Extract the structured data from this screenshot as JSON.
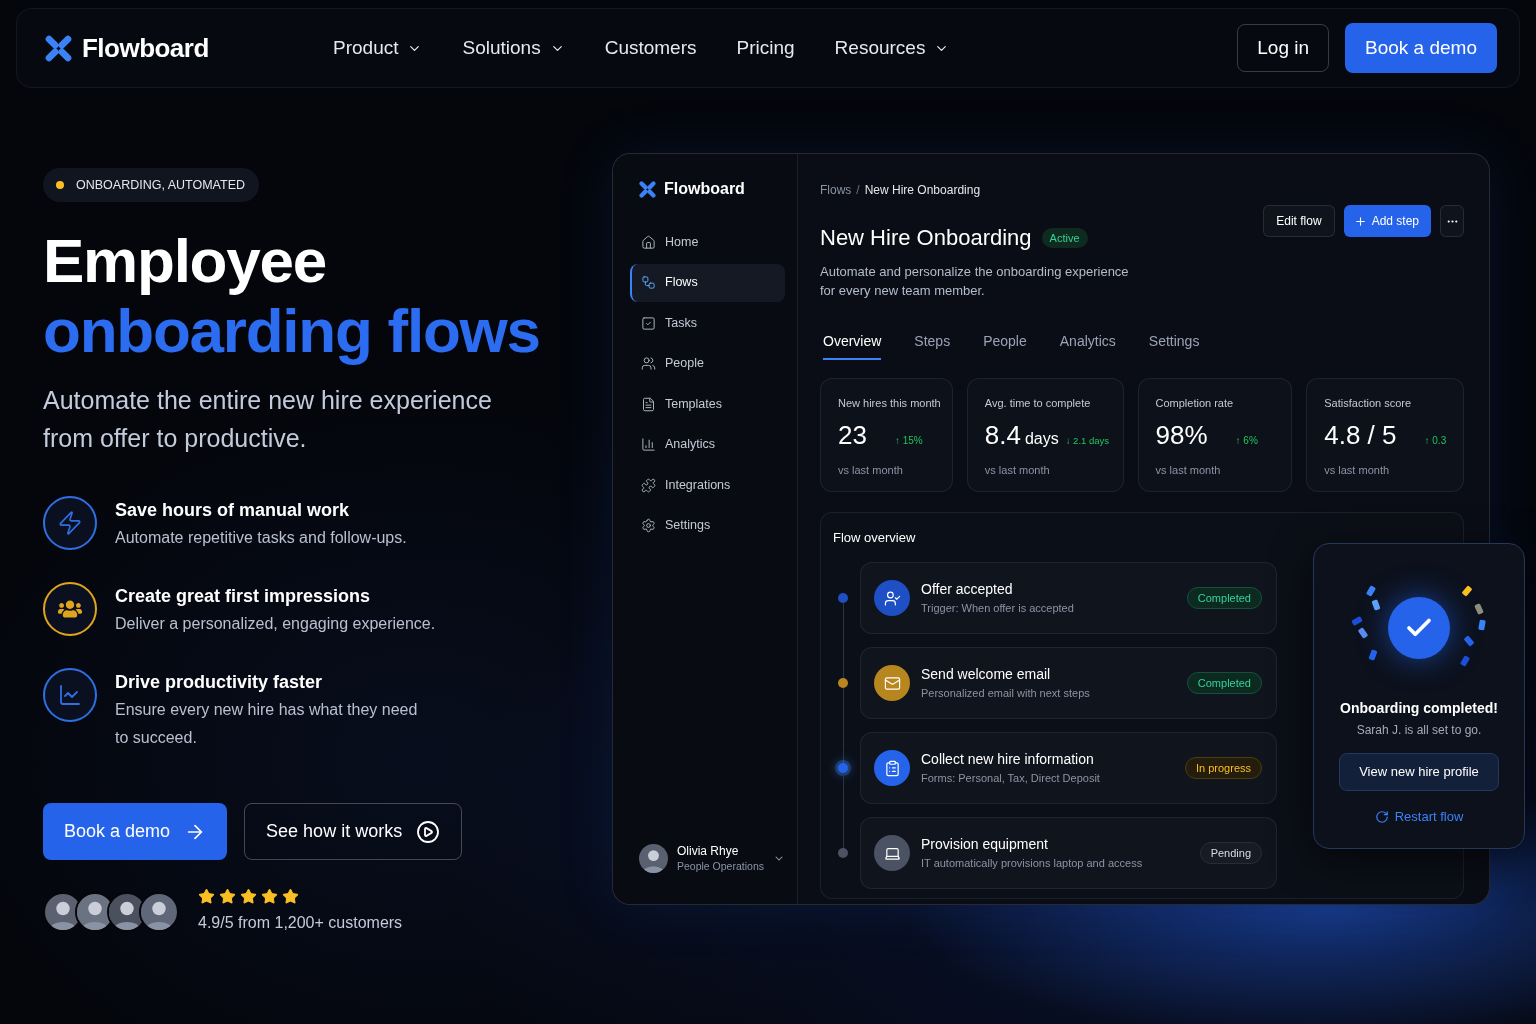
{
  "nav": {
    "logo": "Flowboard",
    "links": [
      {
        "label": "Product",
        "has_menu": true
      },
      {
        "label": "Solutions",
        "has_menu": true
      },
      {
        "label": "Customers",
        "has_menu": false
      },
      {
        "label": "Pricing",
        "has_menu": false
      },
      {
        "label": "Resources",
        "has_menu": true
      }
    ],
    "login": "Log in",
    "cta": "Book a demo"
  },
  "hero": {
    "eyebrow": "ONBOARDING, AUTOMATED",
    "title": "Employee",
    "title_accent": "onboarding flows",
    "subtitle": "Automate the entire new hire experience from offer to productive.",
    "features": [
      {
        "kind": "bolt",
        "color": "#2f6fe4",
        "title": "Save hours of manual work",
        "text": "Automate repetitive tasks and follow-ups."
      },
      {
        "kind": "team",
        "color": "#e0a51e",
        "title": "Create great first impressions",
        "text": "Deliver a personalized, engaging experience."
      },
      {
        "kind": "growth",
        "color": "#2f6fe4",
        "title": "Drive productivity faster",
        "text": "Ensure every new hire has what they need\nto succeed."
      }
    ],
    "primary_button": "Book a demo",
    "secondary_button": "See how it works",
    "rating": {
      "stars": 5,
      "text": "4.9/5 from 1,200+ customers"
    }
  },
  "app": {
    "logo": "Flowboard",
    "sidebar": {
      "items": [
        {
          "kind": "home",
          "label": "Home",
          "selected": false
        },
        {
          "kind": "flows",
          "label": "Flows",
          "selected": true
        },
        {
          "kind": "tasks",
          "label": "Tasks",
          "selected": false
        },
        {
          "kind": "people",
          "label": "People",
          "selected": false
        },
        {
          "kind": "templates",
          "label": "Templates",
          "selected": false
        },
        {
          "kind": "analytics",
          "label": "Analytics",
          "selected": false
        },
        {
          "kind": "integrations",
          "label": "Integrations",
          "selected": false
        },
        {
          "kind": "settings",
          "label": "Settings",
          "selected": false
        }
      ]
    },
    "user": {
      "name": "Olivia Rhye",
      "role": "People Operations"
    },
    "breadcrumb": {
      "items": [
        "Flows",
        "New Hire Onboarding"
      ],
      "separator": "/"
    },
    "title": "New Hire Onboarding",
    "status": "Active",
    "description": "Automate and personalize the onboarding experience for every new team member.",
    "actions": {
      "edit": "Edit flow",
      "add": "Add step"
    },
    "tabs": [
      {
        "label": "Overview",
        "selected": true
      },
      {
        "label": "Steps",
        "selected": false
      },
      {
        "label": "People",
        "selected": false
      },
      {
        "label": "Analytics",
        "selected": false
      },
      {
        "label": "Settings",
        "selected": false
      }
    ],
    "stats": [
      {
        "label": "New hires this month",
        "value": "23",
        "delta": "↑ 15%",
        "note": "vs last month"
      },
      {
        "label": "Avg. time to complete",
        "value": "8.4",
        "unit": "days",
        "delta": "↓ 2.1 days",
        "note": "vs last month"
      },
      {
        "label": "Completion rate",
        "value": "98%",
        "delta": "↑ 6%",
        "note": "vs last month"
      },
      {
        "label": "Satisfaction score",
        "value": "4.8 / 5",
        "delta": "↑ 0.3",
        "note": "vs last month"
      }
    ],
    "flow": {
      "title": "Flow overview",
      "steps": [
        {
          "kind": "offer",
          "color": "#1f4fc4",
          "title": "Offer accepted",
          "subtitle": "Trigger: When offer is accepted",
          "status": {
            "kind": "completed",
            "label": "Completed"
          }
        },
        {
          "kind": "email",
          "color": "#b7861f",
          "title": "Send welcome email",
          "subtitle": "Personalized email with next steps",
          "status": {
            "kind": "completed",
            "label": "Completed"
          }
        },
        {
          "kind": "form",
          "color": "#2563eb",
          "title": "Collect new hire information",
          "subtitle": "Forms: Personal, Tax, Direct Deposit",
          "status": {
            "kind": "in_progress",
            "label": "In progress"
          }
        },
        {
          "kind": "equipment",
          "color": "#4b5263",
          "title": "Provision equipment",
          "subtitle": "IT automatically provisions laptop and access",
          "status": {
            "kind": "pending",
            "label": "Pending"
          }
        }
      ]
    }
  },
  "toast": {
    "title": "Onboarding completed!",
    "text": "Sarah J. is all set to go.",
    "button": "View new hire profile",
    "link": "Restart flow"
  }
}
